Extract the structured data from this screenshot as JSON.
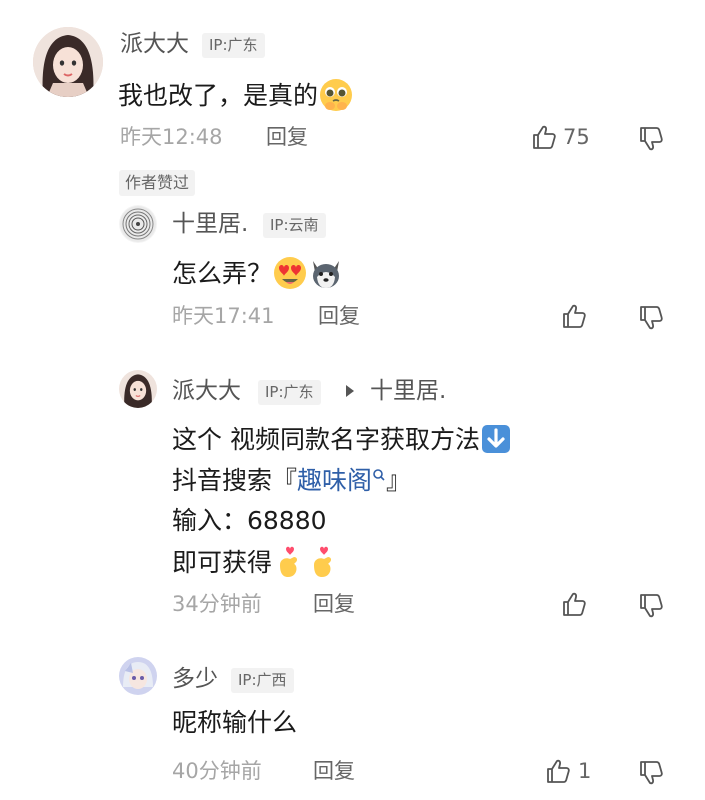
{
  "comments": [
    {
      "username": "派大大",
      "ip": "IP:广东",
      "text": "我也改了，是真的",
      "time": "昨天12:48",
      "reply": "回复",
      "likes": "75",
      "tag": "作者赞过",
      "avatar_icon": "girl-portrait-avatar",
      "emoji_icons": [
        "pleading-face-emoji"
      ]
    },
    {
      "username": "十里居.",
      "ip": "IP:云南",
      "text": "怎么弄？",
      "time": "昨天17:41",
      "reply": "回复",
      "avatar_icon": "ring-pattern-avatar",
      "emoji_icons": [
        "heart-eyes-emoji",
        "husky-dog-emoji"
      ]
    },
    {
      "username": "派大大",
      "ip": "IP:广东",
      "reply_to": "十里居.",
      "lines": {
        "l1": "这个 视频同款名字获取方法",
        "l2_prefix": "抖音搜索『",
        "l2_link": "趣味阁",
        "l2_suffix": "』",
        "l3": "输入：68880",
        "l4": "即可获得"
      },
      "time": "34分钟前",
      "reply": "回复",
      "avatar_icon": "girl-portrait-avatar",
      "emoji_icons": [
        "down-arrow-emoji",
        "finger-heart-emoji",
        "finger-heart-emoji"
      ]
    },
    {
      "username": "多少",
      "ip": "IP:广西",
      "text": "昵称输什么",
      "time": "40分钟前",
      "reply": "回复",
      "likes": "1",
      "avatar_icon": "anime-character-avatar"
    }
  ]
}
